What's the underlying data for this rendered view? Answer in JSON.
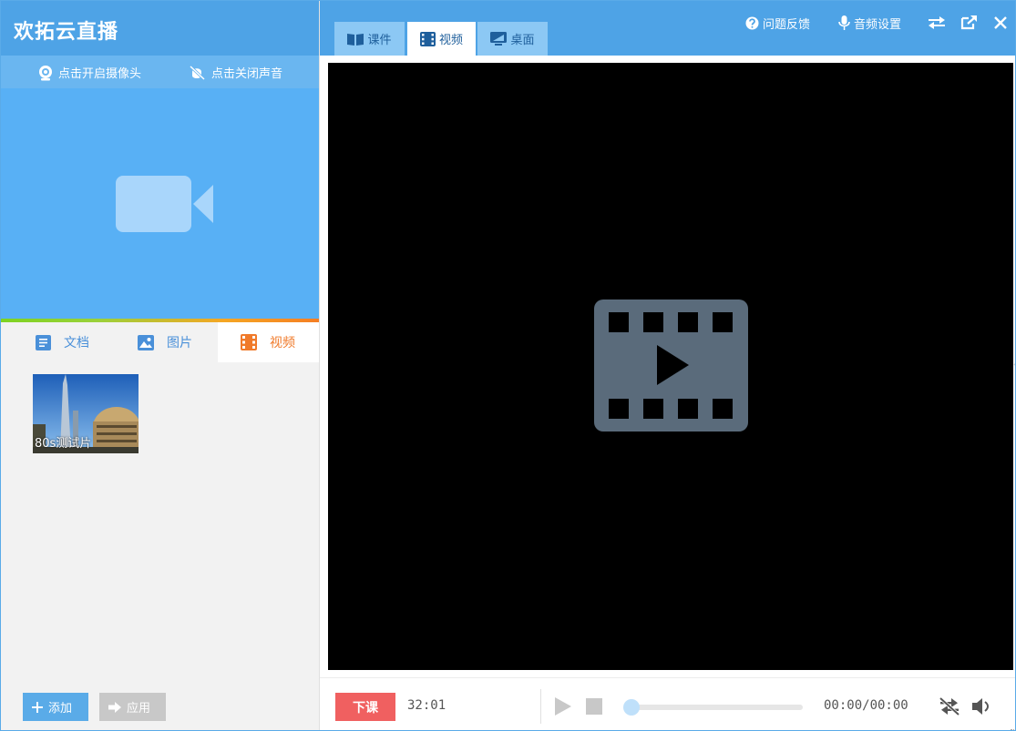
{
  "app": {
    "title": "欢拓云直播"
  },
  "camera_bar": {
    "camera_label": "点击开启摄像头",
    "sound_label": "点击关闭声音"
  },
  "media_tabs": {
    "items": [
      {
        "label": "文档",
        "icon": "document-icon",
        "selected": false
      },
      {
        "label": "图片",
        "icon": "image-icon",
        "selected": false
      },
      {
        "label": "视频",
        "icon": "film-icon",
        "selected": true
      }
    ]
  },
  "media_list": {
    "items": [
      {
        "caption": "80s测试片",
        "type": "video"
      }
    ]
  },
  "footer": {
    "add_label": "添加",
    "apply_label": "应用"
  },
  "main_tabs": {
    "items": [
      {
        "label": "课件",
        "icon": "book-icon",
        "selected": false
      },
      {
        "label": "视频",
        "icon": "film-icon",
        "selected": true
      },
      {
        "label": "桌面",
        "icon": "monitor-icon",
        "selected": false
      }
    ]
  },
  "toolbar": {
    "feedback_label": "问题反馈",
    "audio_settings_label": "音频设置"
  },
  "player": {
    "end_class_label": "下课",
    "elapsed": "32:01",
    "time_display": "00:00/00:00",
    "progress": 0
  },
  "colors": {
    "primary": "#4ea3e6",
    "accent_orange": "#f07a2a",
    "danger": "#f06060",
    "stage": "#000000"
  }
}
